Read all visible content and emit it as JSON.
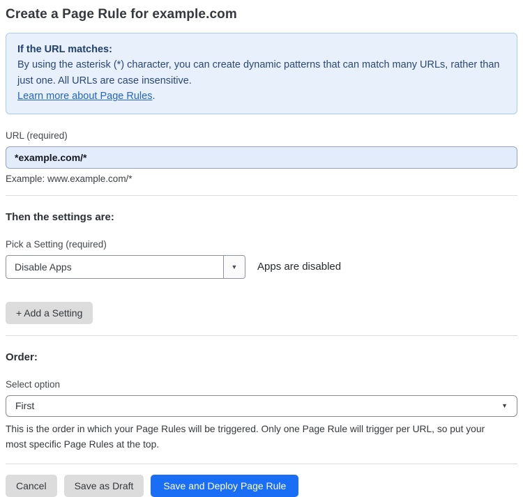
{
  "page": {
    "title": "Create a Page Rule for example.com"
  },
  "info_box": {
    "heading": "If the URL matches:",
    "body": "By using the asterisk (*) character, you can create dynamic patterns that can match many URLs, rather than just one. All URLs are case insensitive.",
    "link_label": "Learn more about Page Rules",
    "link_suffix": "."
  },
  "url_field": {
    "label": "URL (required)",
    "value": "*example.com/*",
    "example": "Example: www.example.com/*"
  },
  "settings": {
    "heading": "Then the settings are:",
    "picker_label": "Pick a Setting (required)",
    "selected_setting": "Disable Apps",
    "status_text": "Apps are disabled",
    "add_setting_label": "+ Add a Setting"
  },
  "order": {
    "heading": "Order:",
    "select_label": "Select option",
    "selected_option": "First",
    "help_text": "This is the order in which your Page Rules will be triggered. Only one Page Rule will trigger per URL, so put your most specific Page Rules at the top."
  },
  "footer": {
    "cancel_label": "Cancel",
    "save_draft_label": "Save as Draft",
    "save_deploy_label": "Save and Deploy Page Rule"
  },
  "icons": {
    "dropdown_arrow": "▼"
  },
  "colors": {
    "accent_blue": "#1a6ef5",
    "info_box_bg": "#e8f1fb",
    "info_box_border": "#aacaee",
    "info_text": "#2a4677",
    "link_blue": "#2264c8",
    "url_input_bg": "#e2ecfa",
    "secondary_button_bg": "#dcdcdc"
  }
}
